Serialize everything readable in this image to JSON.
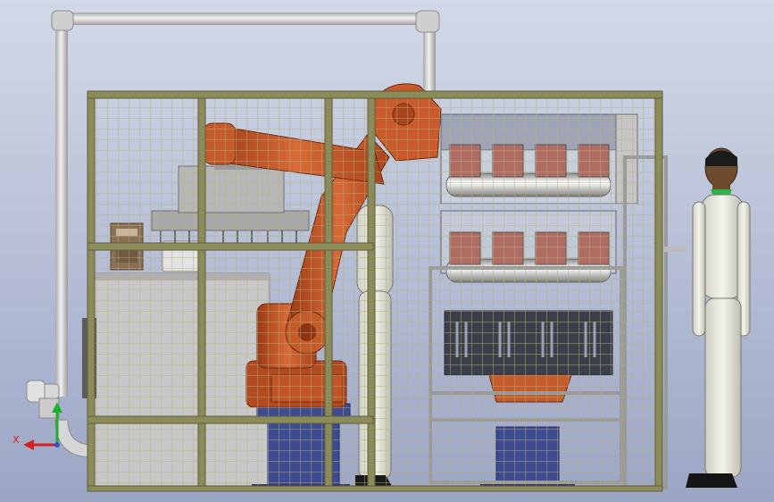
{
  "scene": {
    "background_top": "#cdd5e6",
    "background_bottom": "#9ea9c7",
    "colors": {
      "fence": "#8f8e5e",
      "fence_mesh": "#b5b27a",
      "pipe": "#d8d8d8",
      "robot": "#c8562a",
      "robot_dark": "#8f3212",
      "base_blue": "#3d4a8f",
      "frame_gray": "#b9b9b9",
      "cabinet": "#c9c9c9",
      "skin": "#6b4a2d",
      "suit": "#e8e8de"
    }
  },
  "triad": {
    "x_label": "X",
    "x_color": "#d42020",
    "y_color": "#20b030"
  }
}
